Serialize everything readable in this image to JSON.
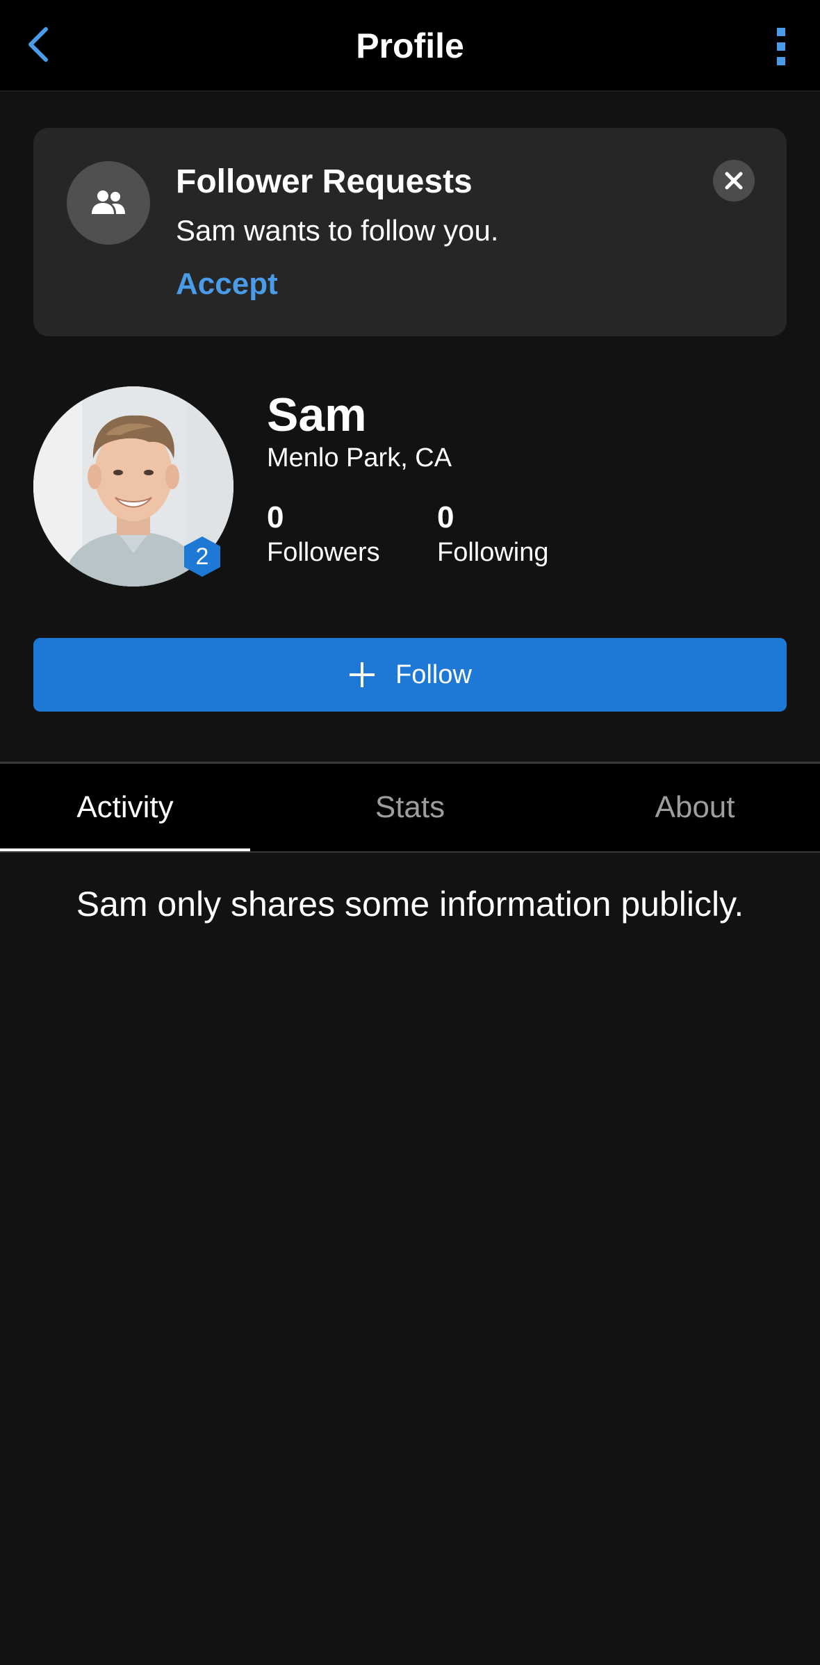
{
  "header": {
    "title": "Profile",
    "back_icon": "chevron-left-icon",
    "menu_icon": "more-vertical-icon"
  },
  "follower_request": {
    "title": "Follower Requests",
    "message": "Sam wants to follow you.",
    "accept_label": "Accept",
    "icon": "people-icon",
    "close_icon": "close-icon"
  },
  "profile": {
    "name": "Sam",
    "location": "Menlo Park, CA",
    "badge_level": "2",
    "followers_count": "0",
    "followers_label": "Followers",
    "following_count": "0",
    "following_label": "Following"
  },
  "follow_button": {
    "label": "Follow",
    "icon": "plus-icon"
  },
  "tabs": [
    {
      "label": "Activity",
      "active": true
    },
    {
      "label": "Stats",
      "active": false
    },
    {
      "label": "About",
      "active": false
    }
  ],
  "privacy_note": "Sam only shares some information publicly.",
  "colors": {
    "accent": "#1d78d6",
    "link": "#4a9be8",
    "background": "#121212",
    "card": "#262626"
  }
}
